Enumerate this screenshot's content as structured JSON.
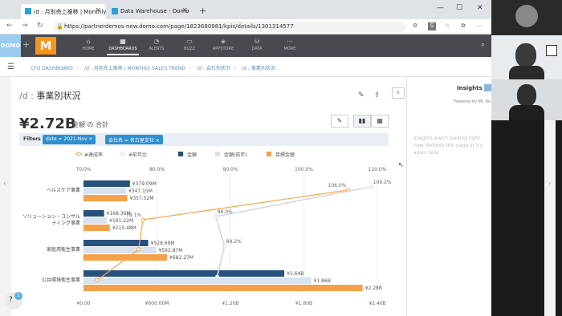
{
  "browser": {
    "tabs": [
      {
        "title": "/d : 月別売上推移 | Monthly Sales",
        "active": true
      },
      {
        "title": "Data Warehouse - Domo",
        "active": false
      }
    ],
    "new_tab": "+",
    "win_min": "—",
    "win_max": "☐",
    "win_close": "✕",
    "url": "https://partnerdemos-new.domo.com/page/1823680981/kpis/details/1301314577"
  },
  "domo_nav": {
    "logo": "DOMO",
    "plus": "+",
    "app_letter": "M",
    "items": [
      {
        "label": "HOME",
        "icon": "⌂"
      },
      {
        "label": "DASHBOARDS",
        "icon": "▦",
        "active": true
      },
      {
        "label": "ALERTS",
        "icon": "◔"
      },
      {
        "label": "BUZZ",
        "icon": "▭"
      },
      {
        "label": "APPSTORE",
        "icon": "◈"
      },
      {
        "label": "DATA",
        "icon": "⛁"
      },
      {
        "label": "MORE",
        "icon": "⋯"
      }
    ]
  },
  "breadcrumb": {
    "items": [
      "CFO DASHBOARD",
      "/d : 月別売上推移 | MONTHLY SALES TREND",
      "/d : 会社別状況",
      "/d : 事業別状況"
    ]
  },
  "card": {
    "title_prefix": "/d : ",
    "title": "事業別状況",
    "summary_value": "¥2.72B",
    "summary_label": "金額 の 合計",
    "filters_label": "Filters",
    "filter_chips": [
      "date = 2021-Nov  ×",
      "会社名 = 名古屋支社  ×"
    ]
  },
  "insights": {
    "title": "Insights",
    "badge": "",
    "powered_by": "Powered by Mr. Ro",
    "message": "Insights aren't loading right now. Refresh this page or try again later."
  },
  "chart_data": {
    "type": "bar",
    "title": "",
    "categories": [
      "ヘルスケア事業",
      "ソリューション・コンサルティング事業",
      "家庭用衛生事業",
      "公共環境衛生事業"
    ],
    "category_lines": [
      [
        "ヘルスケア事業"
      ],
      [
        "ソリューション・コンサル",
        "ティング事業"
      ],
      [
        "家庭用衛生事業"
      ],
      [
        "公共環境衛生事業"
      ]
    ],
    "legend": [
      {
        "name": "#達成率",
        "color": "#f7a54a",
        "kind": "line"
      },
      {
        "name": "#前年比",
        "color": "#d8dde3",
        "kind": "line"
      },
      {
        "name": "金額",
        "color": "#27507d",
        "kind": "bar"
      },
      {
        "name": "金額(前年)",
        "color": "#d6e3ef",
        "kind": "bar"
      },
      {
        "name": "目標金額",
        "color": "#f5a04a",
        "kind": "bar"
      }
    ],
    "series": [
      {
        "name": "金額",
        "values": [
          379.09,
          168.36,
          528.69,
          1640
        ],
        "labels": [
          "¥379.09M",
          "¥168.36M",
          "¥528.69M",
          "¥1.64B"
        ]
      },
      {
        "name": "金額(前年)",
        "values": [
          347.15,
          191.22,
          592.87,
          1860
        ],
        "labels": [
          "¥347.15M",
          "¥191.22M",
          "¥592.87M",
          "¥1.86B"
        ]
      },
      {
        "name": "目標金額",
        "values": [
          357.52,
          215.48,
          682.27,
          2280
        ],
        "labels": [
          "¥357.52M",
          "¥215.48M",
          "¥682.27M",
          "¥2.28B"
        ]
      }
    ],
    "lines": [
      {
        "name": "#達成率",
        "values": [
          106.0,
          78.1,
          77.5,
          71.9
        ],
        "labels": [
          "106.0%",
          "78.1%",
          "",
          ""
        ]
      },
      {
        "name": "#前年比",
        "values": [
          109.2,
          88.0,
          89.2,
          88.2
        ],
        "labels": [
          "109.2%",
          "88.0%",
          "89.2%",
          ""
        ]
      }
    ],
    "x_ticks": [
      "¥0.00",
      "¥600.00M",
      "¥1.20B",
      "¥1.80B",
      "¥2.40B"
    ],
    "x_range": [
      0,
      2400
    ],
    "pct_ticks": [
      "70.0%",
      "80.0%",
      "90.0%",
      "100.0%",
      "110.0%"
    ],
    "pct_range": [
      70,
      110
    ]
  },
  "help": {
    "icon": "?",
    "badge": "1"
  }
}
